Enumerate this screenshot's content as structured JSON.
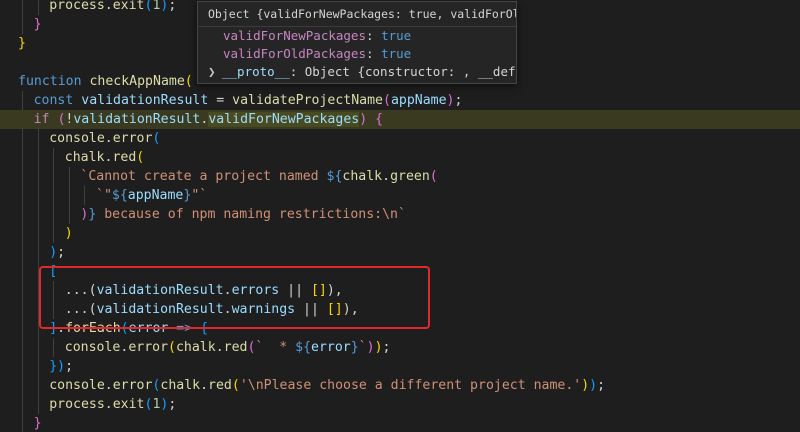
{
  "editor": {
    "language": "javascript",
    "lines": [
      {
        "indent": 2,
        "tokens": [
          [
            "fn",
            "process"
          ],
          [
            "pun",
            "."
          ],
          [
            "fn",
            "exit"
          ],
          [
            "brk3",
            "("
          ],
          [
            "num",
            "1"
          ],
          [
            "brk3",
            ")"
          ],
          [
            "pun",
            ";"
          ]
        ]
      },
      {
        "indent": 1,
        "tokens": [
          [
            "brk2",
            "}"
          ]
        ]
      },
      {
        "indent": 0,
        "tokens": [
          [
            "brk",
            "}"
          ]
        ]
      },
      {
        "indent": 0,
        "tokens": []
      },
      {
        "indent": 0,
        "tokens": [
          [
            "kw",
            "function"
          ],
          [
            "pun",
            " "
          ],
          [
            "fn",
            "checkAppName"
          ],
          [
            "brk",
            "("
          ]
        ]
      },
      {
        "indent": 1,
        "tokens": [
          [
            "kw",
            "const"
          ],
          [
            "pun",
            " "
          ],
          [
            "var",
            "validationResult"
          ],
          [
            "pun",
            " = "
          ],
          [
            "fn",
            "validateProjectName"
          ],
          [
            "brk2",
            "("
          ],
          [
            "var",
            "appName"
          ],
          [
            "brk2",
            ")"
          ],
          [
            "pun",
            ";"
          ]
        ]
      },
      {
        "indent": 1,
        "highlight": true,
        "tokens": [
          [
            "ctl",
            "if"
          ],
          [
            "pun",
            " "
          ],
          [
            "brk2",
            "("
          ],
          [
            "pun",
            "!"
          ],
          [
            "var",
            "validationResult"
          ],
          [
            "pun",
            "."
          ],
          [
            "var_hl",
            "validForNewPackages"
          ],
          [
            "brk2",
            ")"
          ],
          [
            "pun",
            " "
          ],
          [
            "brk2",
            "{"
          ]
        ]
      },
      {
        "indent": 2,
        "tokens": [
          [
            "fn",
            "console"
          ],
          [
            "pun",
            "."
          ],
          [
            "fn",
            "error"
          ],
          [
            "brk3",
            "("
          ]
        ]
      },
      {
        "indent": 3,
        "tokens": [
          [
            "fn",
            "chalk"
          ],
          [
            "pun",
            "."
          ],
          [
            "fn",
            "red"
          ],
          [
            "brk",
            "("
          ]
        ]
      },
      {
        "indent": 4,
        "tokens": [
          [
            "str",
            "`Cannot create a project named "
          ],
          [
            "kw",
            "${"
          ],
          [
            "fn",
            "chalk"
          ],
          [
            "pun",
            "."
          ],
          [
            "fn",
            "green"
          ],
          [
            "brk2",
            "("
          ]
        ]
      },
      {
        "indent": 5,
        "tokens": [
          [
            "str",
            "`\""
          ],
          [
            "kw",
            "${"
          ],
          [
            "var",
            "appName"
          ],
          [
            "kw",
            "}"
          ],
          [
            "str",
            "\"`"
          ]
        ]
      },
      {
        "indent": 4,
        "tokens": [
          [
            "brk2",
            ")"
          ],
          [
            "kw",
            "}"
          ],
          [
            "str",
            " because of npm naming restrictions:\\n`"
          ]
        ]
      },
      {
        "indent": 3,
        "tokens": [
          [
            "brk",
            ")"
          ]
        ]
      },
      {
        "indent": 2,
        "tokens": [
          [
            "brk3",
            ")"
          ],
          [
            "pun",
            ";"
          ]
        ]
      },
      {
        "indent": 2,
        "tokens": [
          [
            "brk3",
            "["
          ]
        ]
      },
      {
        "indent": 3,
        "tokens": [
          [
            "pun",
            "...("
          ],
          [
            "var",
            "validationResult"
          ],
          [
            "pun",
            "."
          ],
          [
            "var",
            "errors"
          ],
          [
            "pun",
            " || "
          ],
          [
            "brk",
            "[]"
          ],
          [
            "pun",
            "),"
          ]
        ]
      },
      {
        "indent": 3,
        "tokens": [
          [
            "pun",
            "...("
          ],
          [
            "var",
            "validationResult"
          ],
          [
            "pun",
            "."
          ],
          [
            "var",
            "warnings"
          ],
          [
            "pun",
            " || "
          ],
          [
            "brk",
            "[]"
          ],
          [
            "pun",
            "),"
          ]
        ]
      },
      {
        "indent": 2,
        "tokens": [
          [
            "brk3",
            "]"
          ],
          [
            "pun",
            "."
          ],
          [
            "fn",
            "forEach"
          ],
          [
            "brk3",
            "("
          ],
          [
            "var",
            "error"
          ],
          [
            "pun",
            " "
          ],
          [
            "kw",
            "=>"
          ],
          [
            "pun",
            " "
          ],
          [
            "brk3",
            "{"
          ]
        ]
      },
      {
        "indent": 3,
        "tokens": [
          [
            "fn",
            "console"
          ],
          [
            "pun",
            "."
          ],
          [
            "fn",
            "error"
          ],
          [
            "brk",
            "("
          ],
          [
            "fn",
            "chalk"
          ],
          [
            "pun",
            "."
          ],
          [
            "fn",
            "red"
          ],
          [
            "brk2",
            "("
          ],
          [
            "str",
            "`  * "
          ],
          [
            "kw",
            "${"
          ],
          [
            "var",
            "error"
          ],
          [
            "kw",
            "}"
          ],
          [
            "str",
            "`"
          ],
          [
            "brk2",
            ")"
          ],
          [
            "brk",
            ")"
          ],
          [
            "pun",
            ";"
          ]
        ]
      },
      {
        "indent": 2,
        "tokens": [
          [
            "brk3",
            "}"
          ],
          [
            "brk3",
            ")"
          ],
          [
            "pun",
            ";"
          ]
        ]
      },
      {
        "indent": 2,
        "tokens": [
          [
            "fn",
            "console"
          ],
          [
            "pun",
            "."
          ],
          [
            "fn",
            "error"
          ],
          [
            "brk3",
            "("
          ],
          [
            "fn",
            "chalk"
          ],
          [
            "pun",
            "."
          ],
          [
            "fn",
            "red"
          ],
          [
            "brk",
            "("
          ],
          [
            "str",
            "'\\nPlease choose a different project name.'"
          ],
          [
            "brk",
            ")"
          ],
          [
            "brk3",
            ")"
          ],
          [
            "pun",
            ";"
          ]
        ]
      },
      {
        "indent": 2,
        "tokens": [
          [
            "fn",
            "process"
          ],
          [
            "pun",
            "."
          ],
          [
            "fn",
            "exit"
          ],
          [
            "brk3",
            "("
          ],
          [
            "num",
            "1"
          ],
          [
            "brk3",
            ")"
          ],
          [
            "pun",
            ";"
          ]
        ]
      },
      {
        "indent": 1,
        "tokens": [
          [
            "brk2",
            "}"
          ]
        ]
      }
    ]
  },
  "hover": {
    "title": "Object {validForNewPackages: true, validForOldPac…",
    "rows": [
      {
        "key": "validForNewPackages",
        "sep": ": ",
        "value": "true"
      },
      {
        "key": "validForOldPackages",
        "sep": ": ",
        "value": "true"
      }
    ],
    "proto": {
      "chevron": "❯",
      "key": "__proto__",
      "text": ": Object {constructor: , __define"
    }
  },
  "annotation": {
    "color": "#e02a2a"
  }
}
